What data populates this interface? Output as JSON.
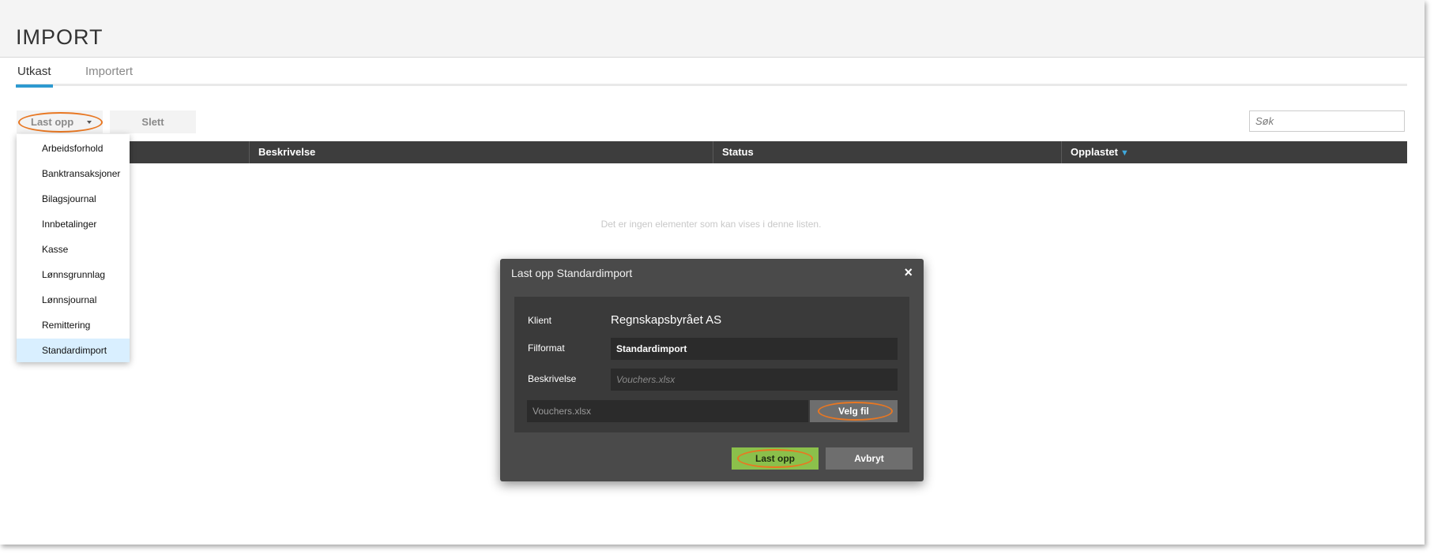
{
  "page": {
    "title": "IMPORT"
  },
  "tabs": [
    {
      "label": "Utkast",
      "active": true
    },
    {
      "label": "Importert",
      "active": false
    }
  ],
  "toolbar": {
    "upload_label": "Last opp",
    "delete_label": "Slett",
    "search_placeholder": "Søk"
  },
  "table": {
    "columns": [
      "Beskrivelse",
      "Status",
      "Opplastet"
    ],
    "sort_indicator": "▼",
    "empty_message": "Det er ingen elementer som kan vises i denne listen."
  },
  "upload_menu": {
    "items": [
      "Arbeidsforhold",
      "Banktransaksjoner",
      "Bilagsjournal",
      "Innbetalinger",
      "Kasse",
      "Lønnsgrunnlag",
      "Lønnsjournal",
      "Remittering",
      "Standardimport"
    ],
    "selected": "Standardimport"
  },
  "dialog": {
    "title": "Last opp Standardimport",
    "close_symbol": "×",
    "client_label": "Klient",
    "client_value": "Regnskapsbyrået AS",
    "format_label": "Filformat",
    "format_value": "Standardimport",
    "description_label": "Beskrivelse",
    "description_placeholder": "Vouchers.xlsx",
    "file_value": "Vouchers.xlsx",
    "choose_file_label": "Velg fil",
    "upload_label": "Last opp",
    "cancel_label": "Avbryt"
  },
  "colors": {
    "accent": "#2e9ad0",
    "highlight": "#e87722",
    "confirm": "#8bc04b",
    "dialog_bg": "#4a4a4a",
    "table_header_bg": "#3d3d3d"
  },
  "icons": {
    "dropdown_caret": "chevron-down-icon",
    "sort": "sort-down-icon",
    "close": "close-icon"
  }
}
